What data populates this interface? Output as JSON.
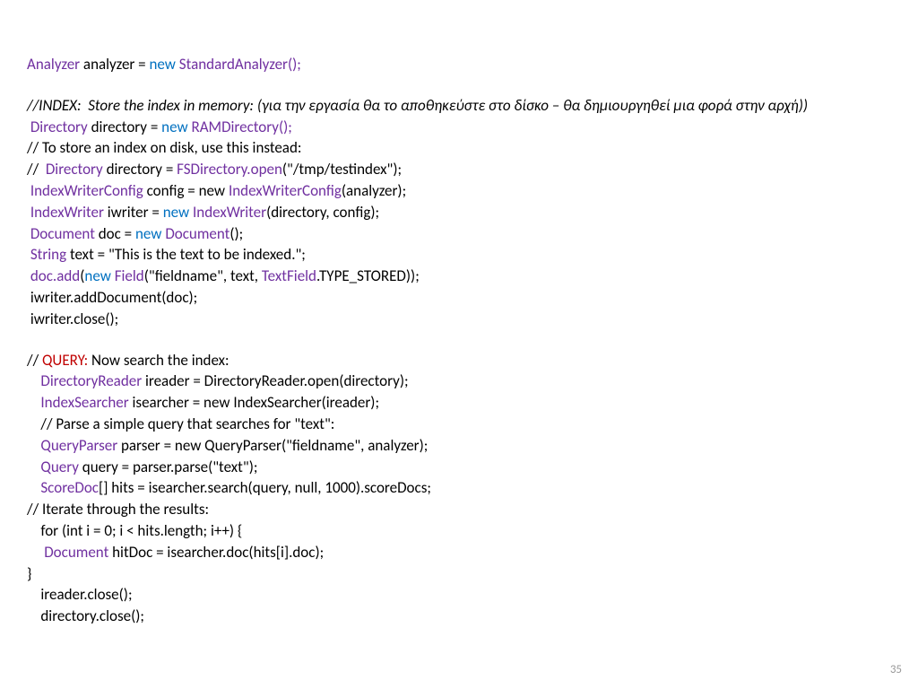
{
  "page_number": "35",
  "l1": {
    "a": "Analyzer",
    "b": " analyzer = ",
    "c": "new",
    "d": " ",
    "e": "StandardAnalyzer();"
  },
  "l2": "//INDEX:  Store the index in memory: (για την εργασία θα το αποθηκεύστε στο δίσκο – θα δημιουργηθεί μια φορά στην αρχή))",
  "l3": {
    "a": " ",
    "b": "Directory",
    "c": " directory = ",
    "d": "new",
    "e": " ",
    "f": "RAMDirectory();"
  },
  "l4": "// To store an index on disk, use this instead:",
  "l5": {
    "a": "//  ",
    "b": "Directory",
    "c": " directory = ",
    "d": "FSDirectory.open",
    "e": "(\"/tmp/testindex\");"
  },
  "l6": {
    "a": " ",
    "b": "IndexWriterConfig",
    "c": " config = new ",
    "d": "IndexWriterConfig",
    "e": "(analyzer);"
  },
  "l7": {
    "a": " ",
    "b": "IndexWriter",
    "c": " iwriter = ",
    "d": "new",
    "e": " ",
    "f": "IndexWriter",
    "g": "(directory, config);"
  },
  "l8": {
    "a": " ",
    "b": "Document",
    "c": " doc = ",
    "d": "new",
    "e": " ",
    "f": "Document",
    "g": "();"
  },
  "l9": {
    "a": " ",
    "b": "String",
    "c": " text = \"This is the text to be indexed.\";"
  },
  "l10": {
    "a": " ",
    "b": "doc.add",
    "c": "(",
    "d": "new",
    "e": " ",
    "f": "Field",
    "g": "(\"fieldname\", text, ",
    "h": "TextField",
    "i": ".TYPE_STORED));"
  },
  "l11": " iwriter.addDocument(doc);",
  "l12": " iwriter.close();",
  "l13": {
    "a": "// ",
    "b": "QUERY:",
    "c": " Now search the index:"
  },
  "l14": {
    "a": "    ",
    "b": "DirectoryReader",
    "c": " ireader = DirectoryReader.open(directory);"
  },
  "l15": {
    "a": "    ",
    "b": "IndexSearcher",
    "c": " isearcher = new IndexSearcher(ireader);"
  },
  "l16": "    // Parse a simple query that searches for \"text\":",
  "l17": {
    "a": "    ",
    "b": "QueryParser",
    "c": " parser = new QueryParser(\"fieldname\", analyzer);"
  },
  "l18": {
    "a": "    ",
    "b": "Query",
    "c": " query = parser.parse(\"text\");"
  },
  "l19": {
    "a": "    ",
    "b": "ScoreDoc",
    "c": "[] hits = isearcher.search(query, null, 1000).scoreDocs;"
  },
  "l20": "// Iterate through the results:",
  "l21": "    for (int i = 0; i < hits.length; i++) {",
  "l22": {
    "a": "     ",
    "b": "Document",
    "c": " hitDoc = isearcher.doc(hits[i].doc);"
  },
  "l23": "}",
  "l24": "    ireader.close();",
  "l25": "    directory.close();"
}
